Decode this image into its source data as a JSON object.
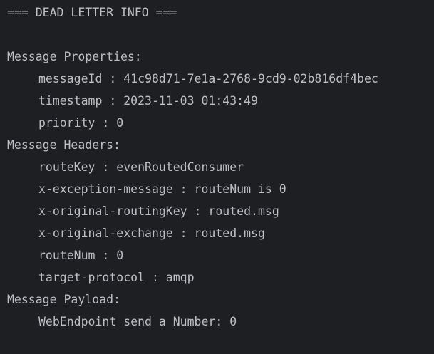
{
  "console": {
    "header": "=== DEAD LETTER INFO ===",
    "sections": {
      "properties": {
        "title": "Message Properties:",
        "items": [
          "messageId : 41c98d71-7e1a-2768-9cd9-02b816df4bec",
          "timestamp : 2023-11-03 01:43:49",
          "priority : 0"
        ]
      },
      "headers": {
        "title": "Message Headers:",
        "items": [
          "routeKey : evenRoutedConsumer",
          "x-exception-message : routeNum is 0",
          "x-original-routingKey : routed.msg",
          "x-original-exchange : routed.msg",
          "routeNum : 0",
          "target-protocol : amqp"
        ]
      },
      "payload": {
        "title": "Message Payload:",
        "items": [
          "WebEndpoint send a Number: 0"
        ]
      }
    }
  }
}
